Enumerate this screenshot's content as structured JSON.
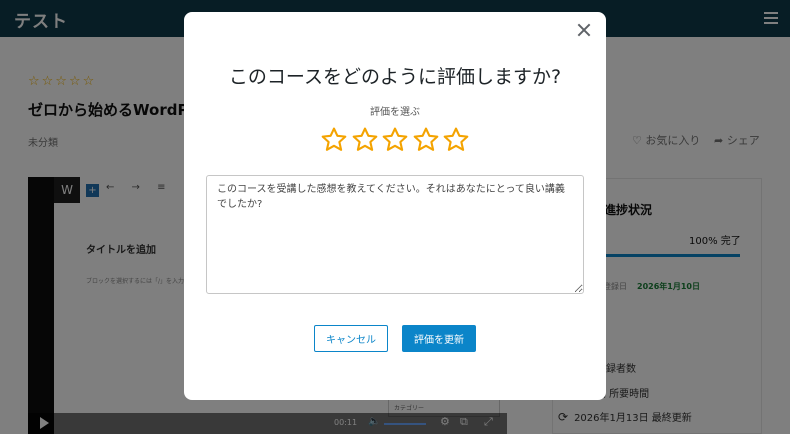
{
  "header": {
    "brand": "テスト",
    "menu_icon": "hamburger-icon"
  },
  "course": {
    "rating_stars": "☆☆☆☆☆",
    "title": "ゼロから始めるWordP",
    "category": "未分類",
    "favorite_label": "♡ お気に入り",
    "share_label": "➦ シェア"
  },
  "video": {
    "wp_logo": "W",
    "tools": "← → ≡",
    "wp_title": "タイトルを追加",
    "wp_hint": "ブロックを選択するには「/」を入力",
    "wp_select": "カテゴリー",
    "time": "00:11"
  },
  "sidebar": {
    "progress_title": "の進捗状況",
    "progress_percent": "100% 完了",
    "progress_value": 1.0,
    "enrolled_label": "登録日",
    "enrolled_date": "2026年1月10日",
    "level": "者",
    "students": "登録者数",
    "duration": "間 所要時間",
    "updated": "2026年1月13日 最終更新"
  },
  "modal": {
    "title": "このコースをどのように評価しますか?",
    "rate_label": "評価を選ぶ",
    "stars_count": 5,
    "selected_rating": 0,
    "star_color": "#f4a300",
    "review_placeholder": "このコースを受講した感想を教えてください。それはあなたにとって良い講義でしたか?",
    "cancel_label": "キャンセル",
    "submit_label": "評価を更新",
    "accent_color": "#0b85c9"
  }
}
